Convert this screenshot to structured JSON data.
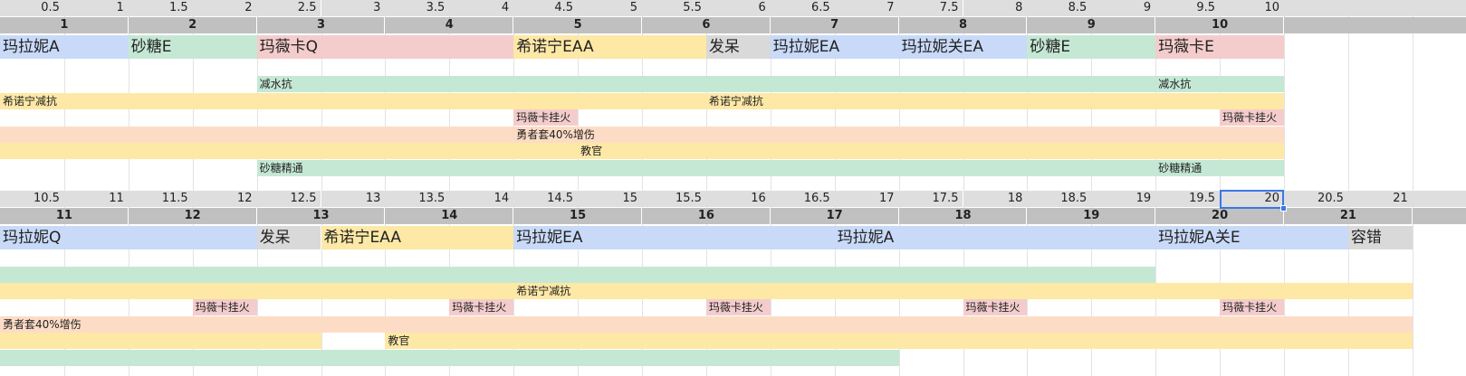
{
  "colors": {
    "blue": "#c9daf8",
    "green": "#c5e8d5",
    "pink": "#f4cccc",
    "yellow": "#fde8a6",
    "orange": "#fddcc6",
    "gray": "#d9d9d9",
    "halfHeader": "#dedede",
    "intHeader": "#c0c0c0",
    "selection": "#3b78e7"
  },
  "block1": {
    "half_labels": [
      "0.5",
      "1",
      "1.5",
      "2",
      "2.5",
      "3",
      "3.5",
      "4",
      "4.5",
      "5",
      "5.5",
      "6",
      "6.5",
      "7",
      "7.5",
      "8",
      "8.5",
      "9",
      "9.5",
      "10"
    ],
    "int_labels": [
      "1",
      "2",
      "3",
      "4",
      "5",
      "6",
      "7",
      "8",
      "9",
      "10"
    ],
    "skills": [
      {
        "label": "玛拉妮A",
        "start": 0,
        "span": 2,
        "color": "blue"
      },
      {
        "label": "砂糖E",
        "start": 2,
        "span": 2,
        "color": "green"
      },
      {
        "label": "玛薇卡Q",
        "start": 4,
        "span": 4,
        "color": "pink"
      },
      {
        "label": "希诺宁EAA",
        "start": 8,
        "span": 3,
        "color": "yellow"
      },
      {
        "label": "发呆",
        "start": 11,
        "span": 1,
        "color": "gray"
      },
      {
        "label": "玛拉妮EA",
        "start": 12,
        "span": 2,
        "color": "blue"
      },
      {
        "label": "玛拉妮关EA",
        "start": 14,
        "span": 2,
        "color": "blue"
      },
      {
        "label": "砂糖E",
        "start": 16,
        "span": 2,
        "color": "green"
      },
      {
        "label": "玛薇卡E",
        "start": 18,
        "span": 2,
        "color": "pink"
      }
    ],
    "buffs": [
      {
        "row": 0,
        "label": "减水抗",
        "start": 4,
        "span": 14,
        "color": "green"
      },
      {
        "row": 0,
        "label": "减水抗",
        "start": 18,
        "span": 2,
        "color": "green"
      },
      {
        "row": 1,
        "label": "希诺宁减抗",
        "start": 0,
        "span": 11,
        "color": "yellow",
        "hide": true
      },
      {
        "row": 1,
        "label": "希诺宁减抗",
        "start": 11,
        "span": 9,
        "color": "yellow"
      },
      {
        "row": 2,
        "label": "玛薇卡挂火",
        "start": 8,
        "span": 1,
        "color": "pink"
      },
      {
        "row": 2,
        "label": "玛薇卡挂火",
        "start": 19,
        "span": 1,
        "color": "pink"
      },
      {
        "row": 3,
        "label": "",
        "start": 0,
        "span": 8,
        "color": "orange"
      },
      {
        "row": 3,
        "label": "勇者套40%增伤",
        "start": 8,
        "span": 12,
        "color": "orange"
      },
      {
        "row": 4,
        "label": "",
        "start": 0,
        "span": 9,
        "color": "yellow"
      },
      {
        "row": 4,
        "label": "教官",
        "start": 9,
        "span": 11,
        "color": "yellow"
      },
      {
        "row": 5,
        "label": "砂糖精通",
        "start": 4,
        "span": 14,
        "color": "green"
      },
      {
        "row": 5,
        "label": "砂糖精通",
        "start": 18,
        "span": 2,
        "color": "green"
      }
    ]
  },
  "block2": {
    "half_labels": [
      "10.5",
      "11",
      "11.5",
      "12",
      "12.5",
      "13",
      "13.5",
      "14",
      "14.5",
      "15",
      "15.5",
      "16",
      "16.5",
      "17",
      "17.5",
      "18",
      "18.5",
      "19",
      "19.5",
      "20",
      "20.5",
      "21"
    ],
    "int_labels": [
      "11",
      "12",
      "13",
      "14",
      "15",
      "16",
      "17",
      "18",
      "19",
      "20",
      "21"
    ],
    "skills": [
      {
        "label": "玛拉妮Q",
        "start": 0,
        "span": 4,
        "color": "blue"
      },
      {
        "label": "发呆",
        "start": 4,
        "span": 1,
        "color": "gray"
      },
      {
        "label": "希诺宁EAA",
        "start": 5,
        "span": 3,
        "color": "yellow"
      },
      {
        "label": "玛拉妮EA",
        "start": 8,
        "span": 5,
        "color": "blue"
      },
      {
        "label": "玛拉妮A",
        "start": 13,
        "span": 5,
        "color": "blue"
      },
      {
        "label": "玛拉妮A关E",
        "start": 18,
        "span": 3,
        "color": "blue"
      },
      {
        "label": "容错",
        "start": 21,
        "span": 1,
        "color": "gray"
      }
    ],
    "buffs": [
      {
        "row": 0,
        "label": "",
        "start": 0,
        "span": 18,
        "color": "green"
      },
      {
        "row": 1,
        "label": "希诺宁减抗",
        "start": 8,
        "span": 14,
        "color": "yellow"
      },
      {
        "row": 1,
        "label": "",
        "start": 0,
        "span": 8,
        "color": "yellow"
      },
      {
        "row": 2,
        "label": "玛薇卡挂火",
        "start": 3,
        "span": 1,
        "color": "pink"
      },
      {
        "row": 2,
        "label": "玛薇卡挂火",
        "start": 7,
        "span": 1,
        "color": "pink"
      },
      {
        "row": 2,
        "label": "玛薇卡挂火",
        "start": 11,
        "span": 1,
        "color": "pink"
      },
      {
        "row": 2,
        "label": "玛薇卡挂火",
        "start": 15,
        "span": 1,
        "color": "pink"
      },
      {
        "row": 2,
        "label": "玛薇卡挂火",
        "start": 19,
        "span": 1,
        "color": "pink"
      },
      {
        "row": 3,
        "label": "勇者套40%增伤",
        "start": 0,
        "span": 22,
        "color": "orange"
      },
      {
        "row": 4,
        "label": "",
        "start": 0,
        "span": 5,
        "color": "yellow"
      },
      {
        "row": 4,
        "label": "教官",
        "start": 6,
        "span": 16,
        "color": "yellow"
      },
      {
        "row": 5,
        "label": "",
        "start": 0,
        "span": 14,
        "color": "green"
      }
    ]
  }
}
